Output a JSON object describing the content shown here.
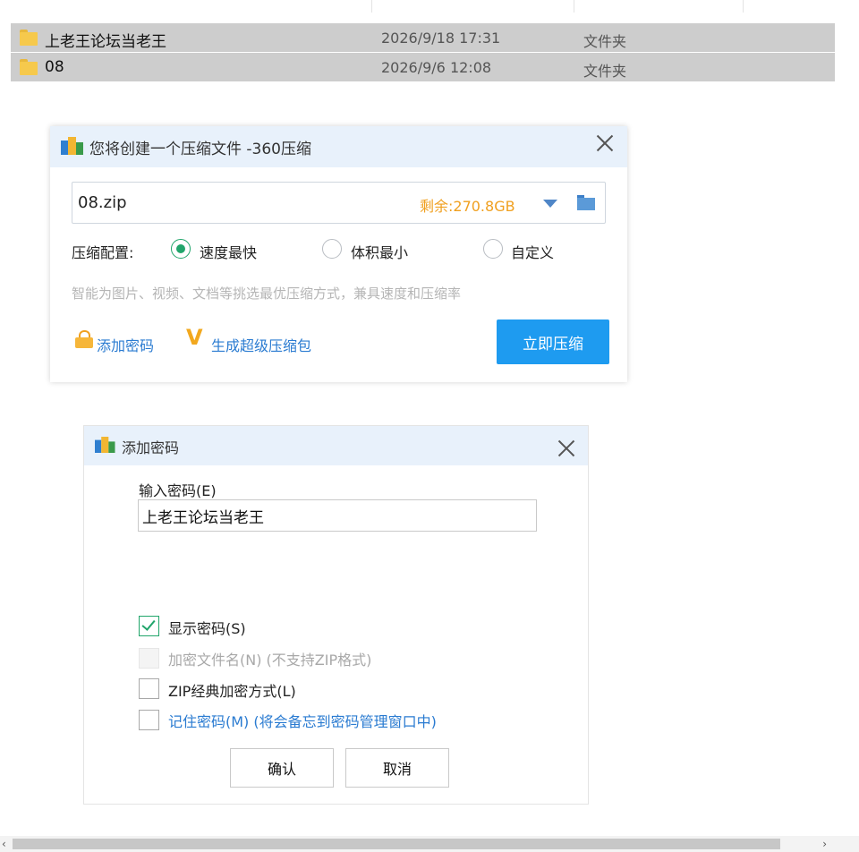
{
  "explorer": {
    "files": [
      {
        "name": "上老王论坛当老王",
        "date": "2026/9/18 17:31",
        "type": "文件夹"
      },
      {
        "name": "08",
        "date": "2026/9/6 12:08",
        "type": "文件夹"
      }
    ]
  },
  "compress_dialog": {
    "title": "您将创建一个压缩文件 -360压缩",
    "filename": "08.zip",
    "free_space": "剩余:270.8GB",
    "config_label": "压缩配置:",
    "options": [
      "速度最快",
      "体积最小",
      "自定义"
    ],
    "selected_option": "速度最快",
    "hint": "智能为图片、视频、文档等挑选最优压缩方式，兼具速度和压缩率",
    "add_password": "添加密码",
    "super_pack": "生成超级压缩包",
    "compress_button": "立即压缩"
  },
  "password_dialog": {
    "title": "添加密码",
    "input_label": "输入密码(E)",
    "password": "上老王论坛当老王",
    "checkboxes": [
      {
        "label": "显示密码(S)",
        "checked": true,
        "disabled": false
      },
      {
        "label": "加密文件名(N) (不支持ZIP格式)",
        "checked": false,
        "disabled": true
      },
      {
        "label": "ZIP经典加密方式(L)",
        "checked": false,
        "disabled": false
      },
      {
        "label": "记住密码(M) (将会备忘到密码管理窗口中)",
        "checked": false,
        "disabled": false
      }
    ],
    "ok_button": "确认",
    "cancel_button": "取消"
  },
  "scrollbar": {
    "left_arrow": "‹",
    "right_arrow": "›"
  },
  "colors": {
    "accent": "#1e9bf0",
    "title_bar": "#e8f1fb",
    "radio_green": "#21a56b",
    "free_space": "#f0a020",
    "link": "#2a7bd1"
  }
}
